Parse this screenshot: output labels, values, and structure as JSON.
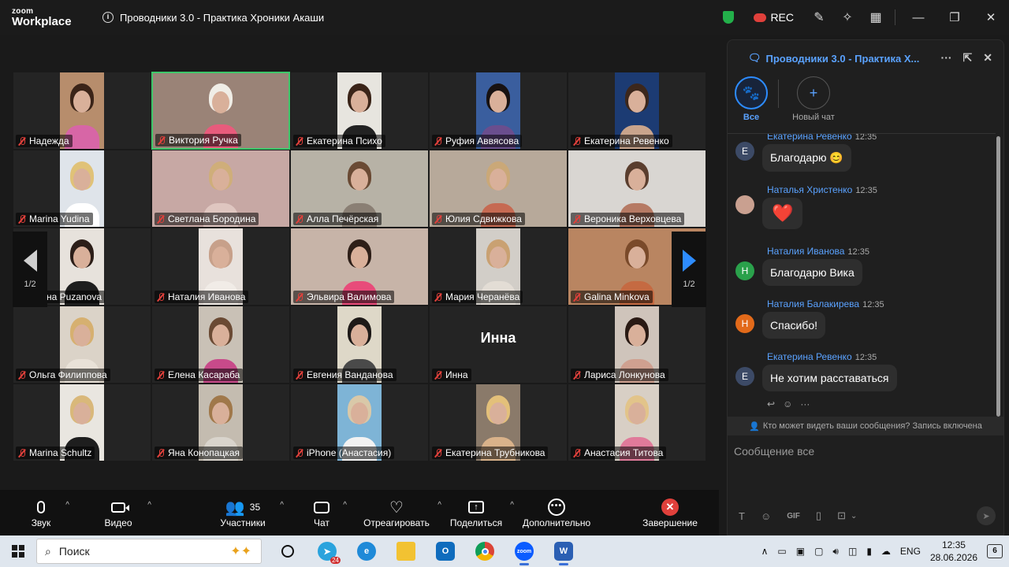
{
  "app": {
    "logo_small": "zoom",
    "logo_big": "Workplace",
    "meeting_title": "Проводники 3.0 - Практика Хроники Акаши",
    "rec_label": "REC"
  },
  "gallery": {
    "page_indicator": "1/2",
    "tiles": [
      {
        "name": "Надежда",
        "photo": "narrow",
        "bg": "#b78d6c",
        "hair": "#3b2418",
        "body": "#d766a6"
      },
      {
        "name": "Виктория Ручка",
        "photo": "wide",
        "bg": "#9a8377",
        "hair": "#f0ede6",
        "body": "#e85b7c",
        "active": true
      },
      {
        "name": "Екатерина Психо",
        "photo": "narrow",
        "bg": "#e7e5df",
        "hair": "#3a2418",
        "body": "#222222"
      },
      {
        "name": "Руфия Аввясова",
        "photo": "narrow",
        "bg": "#3a5e9e",
        "hair": "#181212",
        "body": "#6a4e8e"
      },
      {
        "name": "Екатерина Ревенко",
        "photo": "narrow",
        "bg": "#1c3b73",
        "hair": "#3c271c",
        "body": "#c9a48c"
      },
      {
        "name": "Marina Yudina",
        "photo": "narrow",
        "bg": "#dfe4ea",
        "hair": "#e0c278",
        "body": "#ffffff"
      },
      {
        "name": "Светлана Бородина",
        "photo": "wide",
        "bg": "#c7a8a4",
        "hair": "#cfae7a",
        "body": "#dfc6c0"
      },
      {
        "name": "Алла Печёрская",
        "photo": "wide",
        "bg": "#b7b2a6",
        "hair": "#6a4a34",
        "body": "#8a7f74"
      },
      {
        "name": "Юлия Сдвижкова",
        "photo": "wide",
        "bg": "#b7a99a",
        "hair": "#caa878",
        "body": "#c66a52"
      },
      {
        "name": "Вероника Верховцева",
        "photo": "wide",
        "bg": "#d9d6d2",
        "hair": "#5a3e2e",
        "body": "#b67a64"
      },
      {
        "name": "Ирина Puzanova",
        "photo": "narrow",
        "bg": "#e7e2dc",
        "hair": "#2c1e18",
        "body": "#1e1e1e"
      },
      {
        "name": "Наталия Иванова",
        "photo": "narrow",
        "bg": "#e8e1dc",
        "hair": "#c7a08a",
        "body": "#f1ece7"
      },
      {
        "name": "Эльвира Валимова",
        "photo": "wide",
        "bg": "#c7b4a8",
        "hair": "#2e1f18",
        "body": "#e84b7a"
      },
      {
        "name": "Мария Черанёва",
        "photo": "narrow",
        "bg": "#d2cec8",
        "hair": "#c9a172",
        "body": "#e3ddd5"
      },
      {
        "name": "Galina Minkova",
        "photo": "wide",
        "bg": "#b98561",
        "hair": "#7a4a2a",
        "body": "#c56a42"
      },
      {
        "name": "Ольга Филиппова",
        "photo": "narrow",
        "bg": "#dbd3c8",
        "hair": "#d6b070",
        "body": "#e9e2d8"
      },
      {
        "name": "Елена Касараба",
        "photo": "narrow",
        "bg": "#c9c1b6",
        "hair": "#6a4a34",
        "body": "#c84a8a"
      },
      {
        "name": "Евгения Ванданова",
        "photo": "narrow",
        "bg": "#ded8c8",
        "hair": "#1e1a18",
        "body": "#4a4a4a"
      },
      {
        "name": "Инна",
        "photo": "none"
      },
      {
        "name": "Лариса Лонкунова",
        "photo": "narrow",
        "bg": "#cfc4bb",
        "hair": "#2a1a14",
        "body": "#cfa090"
      },
      {
        "name": "Marina Schultz",
        "photo": "narrow",
        "bg": "#e9e6e0",
        "hair": "#d9b87a",
        "body": "#1e1e1e"
      },
      {
        "name": "Яна Конопацкая",
        "photo": "narrow",
        "bg": "#c4bcb0",
        "hair": "#a0784a",
        "body": "#d9d4cc"
      },
      {
        "name": "iPhone (Анастасия)",
        "photo": "narrow",
        "bg": "#7eb4d6",
        "hair": "#d9c8a8",
        "body": "#f2f2f2"
      },
      {
        "name": "Екатерина Трубникова",
        "photo": "narrow",
        "bg": "#8a7a6a",
        "hair": "#e3c07a",
        "body": "#d9b28a"
      },
      {
        "name": "Анастасия Титова",
        "photo": "narrow",
        "bg": "#d8cfc5",
        "hair": "#e2c48a",
        "body": "#e07a9a"
      }
    ]
  },
  "toolbar": {
    "audio": "Звук",
    "video": "Видео",
    "participants": "Участники",
    "participants_count": "35",
    "chat": "Чат",
    "react": "Отреагировать",
    "share": "Поделиться",
    "more": "Дополнительно",
    "end": "Завершение"
  },
  "chat": {
    "title": "Проводники 3.0 - Практика Х...",
    "tab_all": "Все",
    "tab_new": "Новый чат",
    "messages": [
      {
        "sender": "Екатерина Ревенко",
        "time": "12:35",
        "text": "Благодарю 😊",
        "avatar": "E",
        "avatar_color": "#3c4a66"
      },
      {
        "sender": "Наталья Христенко",
        "time": "12:35",
        "text": "❤️",
        "avatar": "",
        "avatar_color": "#c9a090"
      },
      {
        "sender": "Наталия Иванова",
        "time": "12:35",
        "text": "Благодарю Вика",
        "avatar": "Н",
        "avatar_color": "#2aa14b"
      },
      {
        "sender": "Наталия Балакирева",
        "time": "12:35",
        "text": "Спасибо!",
        "avatar": "Н",
        "avatar_color": "#e26a1a"
      },
      {
        "sender": "Екатерина Ревенко",
        "time": "12:35",
        "text": "Не хотим расставаться",
        "avatar": "E",
        "avatar_color": "#3c4a66"
      }
    ],
    "privacy": "Кто может видеть ваши сообщения? Запись включена",
    "input_placeholder": "Сообщение все"
  },
  "taskbar": {
    "search_placeholder": "Поиск",
    "lang": "ENG",
    "time": "12:35",
    "date": "28.06.2026",
    "notifications": "6",
    "telegram_badge": "24"
  }
}
